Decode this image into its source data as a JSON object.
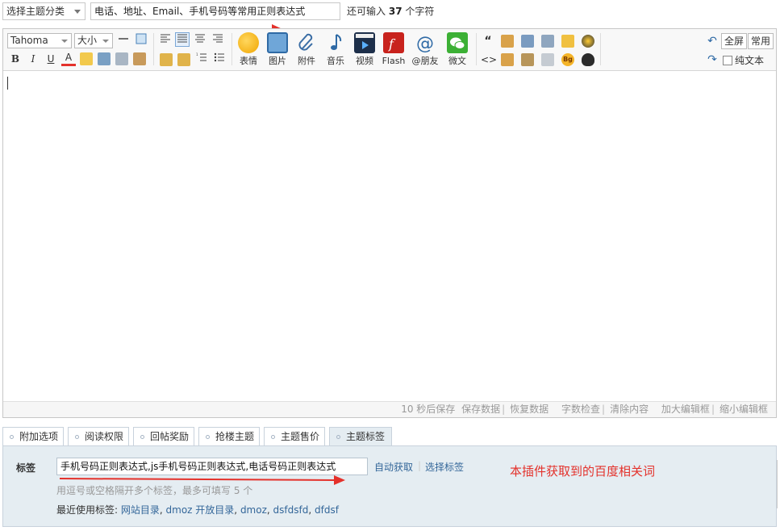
{
  "top": {
    "category_select": "选择主题分类",
    "subject_value": "电话、地址、Email、手机号码等常用正则表达式",
    "remain_prefix": "还可输入",
    "remain_count": "37",
    "remain_suffix": "个字符"
  },
  "toolbar": {
    "font_name": "Tahoma",
    "font_size": "大小",
    "buttons": {
      "emoticon": "表情",
      "image": "图片",
      "attach": "附件",
      "music": "音乐",
      "video": "视频",
      "flash": "Flash",
      "at_friend": "@朋友",
      "weixin": "微文"
    },
    "fullscreen": "全屏",
    "common": "常用",
    "plain_text": "纯文本",
    "format_bold": "B",
    "format_italic": "I",
    "format_underline": "U",
    "format_color": "A",
    "code_glyph": "<>",
    "quote_glyph": "“",
    "bg_glyph": "Bg"
  },
  "status": {
    "autosave": "10 秒后保存",
    "save_data": "保存数据",
    "restore_data": "恢复数据",
    "word_check": "字数检查",
    "clear": "清除内容",
    "enlarge": "加大编辑框",
    "shrink": "缩小编辑框"
  },
  "tabs": [
    "附加选项",
    "阅读权限",
    "回帖奖励",
    "抢楼主题",
    "主题售价",
    "主题标签"
  ],
  "tag_panel": {
    "label": "标签",
    "value": "手机号码正则表达式,js手机号码正则表达式,电话号码正则表达式",
    "auto_fetch": "自动获取",
    "choose": "选择标签",
    "hint": "用逗号或空格隔开多个标签，最多可填写 5 个",
    "recent_label": "最近使用标签:",
    "recent_tags": [
      "网站目录",
      "dmoz 开放目录",
      "dmoz",
      "dsfdsfd",
      "dfdsf"
    ],
    "annotation": "本插件获取到的百度相关词"
  },
  "colors": {
    "accent_red": "#e4312b",
    "link": "#336699",
    "panel_bg": "#e5edf2"
  }
}
